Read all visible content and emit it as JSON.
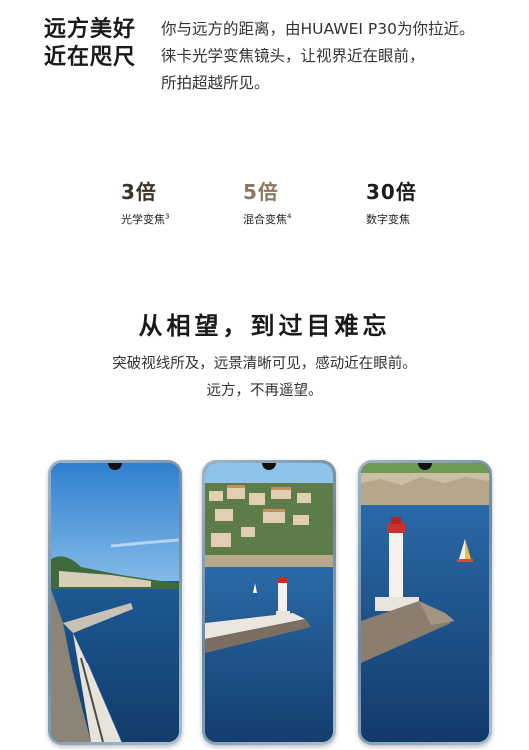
{
  "hero": {
    "title_lines": [
      "远方美好",
      "近在咫尺"
    ],
    "description_lines": [
      "你与远方的距离，由HUAWEI P30为你拉近。",
      "徕卡光学变焦镜头，让视界近在眼前，",
      "所拍超越所见。"
    ]
  },
  "zoom_specs": [
    {
      "value": "3倍",
      "label": "光学变焦",
      "note": "3",
      "color": "#3a3326"
    },
    {
      "value": "5倍",
      "label": "混合变焦",
      "note": "4",
      "color": "#8a7760"
    },
    {
      "value": "30倍",
      "label": "数字变焦",
      "note": "",
      "color": "#1c1c1c"
    }
  ],
  "section": {
    "title": "从相望，到过目难忘",
    "subtitle_lines": [
      "突破视线所及，远景清晰可见，感动近在眼前。",
      "远方，不再遥望。"
    ]
  },
  "phones": [
    {
      "scene": "coastal-city-wide"
    },
    {
      "scene": "harbor-lighthouse-mid"
    },
    {
      "scene": "lighthouse-closeup"
    }
  ],
  "colors": {
    "accent_gold": "#8a7760",
    "text_dark": "#1a1a1a",
    "phone_frame": "#7f9ab0",
    "sea": "#1f4f86"
  }
}
